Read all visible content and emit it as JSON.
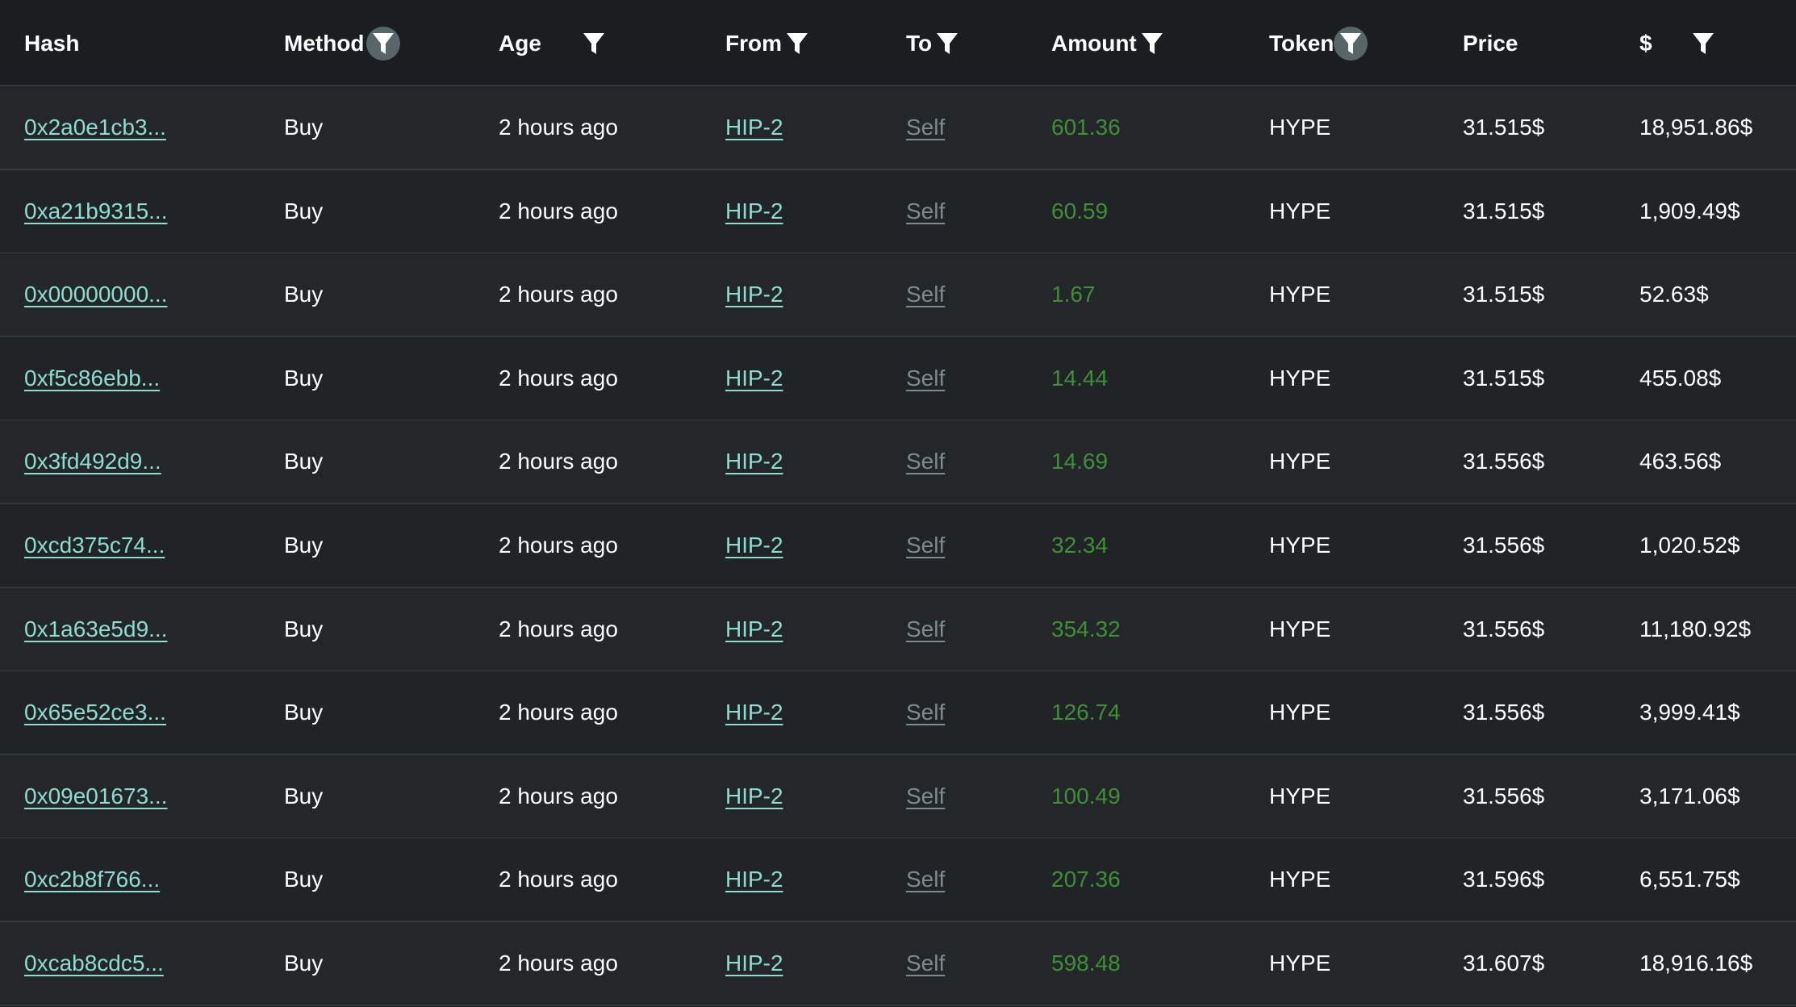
{
  "columns": {
    "hash": "Hash",
    "method": "Method",
    "age": "Age",
    "from": "From",
    "to": "To",
    "amount": "Amount",
    "token": "Token",
    "price": "Price",
    "usd": "$"
  },
  "icons": {
    "filter": "filter-funnel-icon"
  },
  "colors": {
    "background": "#1f2426",
    "header_background": "#1b1e20",
    "link": "#8ddccf",
    "muted_link": "#7e8a8c",
    "amount": "#3f8f37",
    "active_filter_bg": "#58666a"
  },
  "rows": [
    {
      "hash": "0x2a0e1cb3...",
      "method": "Buy",
      "age": "2 hours ago",
      "from": "HIP-2",
      "to": "Self",
      "amount": "601.36",
      "token": "HYPE",
      "price": "31.515$",
      "usd": "18,951.86$"
    },
    {
      "hash": "0xa21b9315...",
      "method": "Buy",
      "age": "2 hours ago",
      "from": "HIP-2",
      "to": "Self",
      "amount": "60.59",
      "token": "HYPE",
      "price": "31.515$",
      "usd": "1,909.49$"
    },
    {
      "hash": "0x00000000...",
      "method": "Buy",
      "age": "2 hours ago",
      "from": "HIP-2",
      "to": "Self",
      "amount": "1.67",
      "token": "HYPE",
      "price": "31.515$",
      "usd": "52.63$"
    },
    {
      "hash": "0xf5c86ebb...",
      "method": "Buy",
      "age": "2 hours ago",
      "from": "HIP-2",
      "to": "Self",
      "amount": "14.44",
      "token": "HYPE",
      "price": "31.515$",
      "usd": "455.08$"
    },
    {
      "hash": "0x3fd492d9...",
      "method": "Buy",
      "age": "2 hours ago",
      "from": "HIP-2",
      "to": "Self",
      "amount": "14.69",
      "token": "HYPE",
      "price": "31.556$",
      "usd": "463.56$"
    },
    {
      "hash": "0xcd375c74...",
      "method": "Buy",
      "age": "2 hours ago",
      "from": "HIP-2",
      "to": "Self",
      "amount": "32.34",
      "token": "HYPE",
      "price": "31.556$",
      "usd": "1,020.52$"
    },
    {
      "hash": "0x1a63e5d9...",
      "method": "Buy",
      "age": "2 hours ago",
      "from": "HIP-2",
      "to": "Self",
      "amount": "354.32",
      "token": "HYPE",
      "price": "31.556$",
      "usd": "11,180.92$"
    },
    {
      "hash": "0x65e52ce3...",
      "method": "Buy",
      "age": "2 hours ago",
      "from": "HIP-2",
      "to": "Self",
      "amount": "126.74",
      "token": "HYPE",
      "price": "31.556$",
      "usd": "3,999.41$"
    },
    {
      "hash": "0x09e01673...",
      "method": "Buy",
      "age": "2 hours ago",
      "from": "HIP-2",
      "to": "Self",
      "amount": "100.49",
      "token": "HYPE",
      "price": "31.556$",
      "usd": "3,171.06$"
    },
    {
      "hash": "0xc2b8f766...",
      "method": "Buy",
      "age": "2 hours ago",
      "from": "HIP-2",
      "to": "Self",
      "amount": "207.36",
      "token": "HYPE",
      "price": "31.596$",
      "usd": "6,551.75$"
    },
    {
      "hash": "0xcab8cdc5...",
      "method": "Buy",
      "age": "2 hours ago",
      "from": "HIP-2",
      "to": "Self",
      "amount": "598.48",
      "token": "HYPE",
      "price": "31.607$",
      "usd": "18,916.16$"
    }
  ]
}
